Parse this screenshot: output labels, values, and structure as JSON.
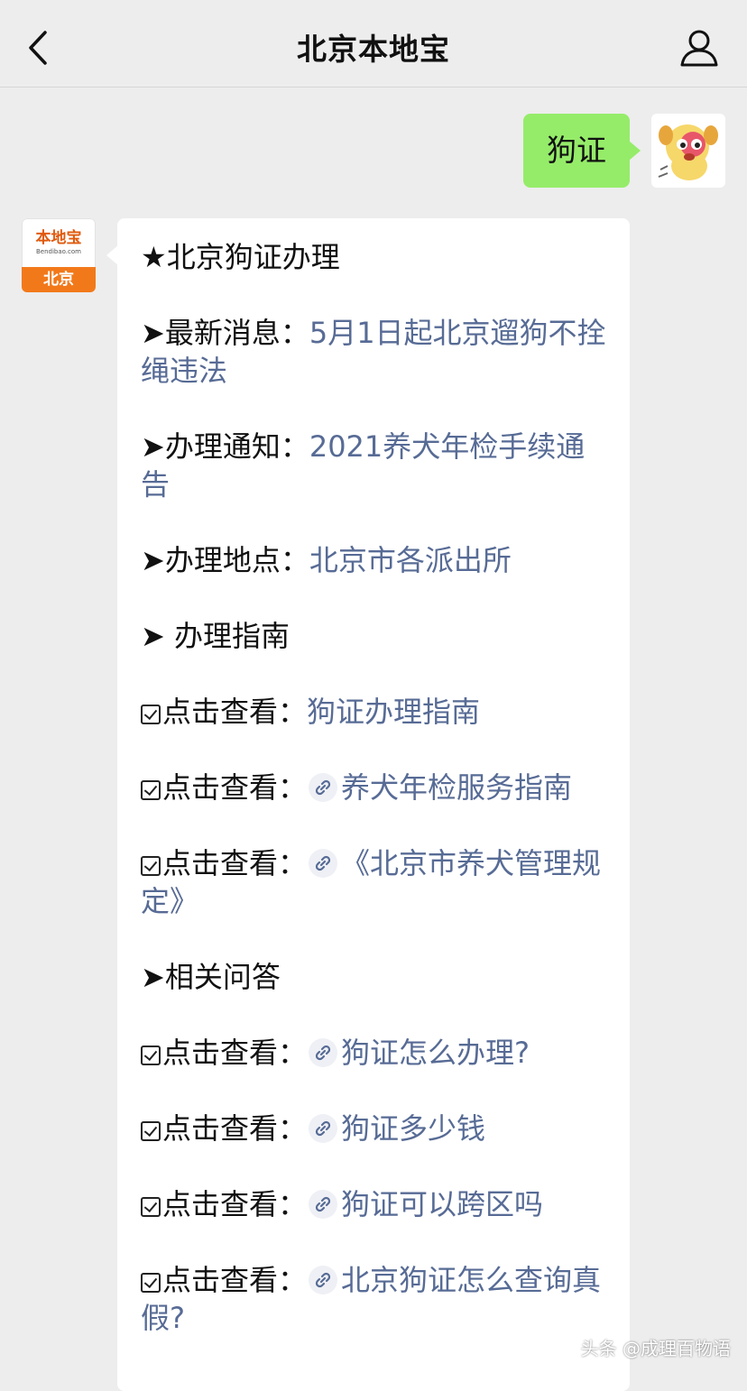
{
  "header": {
    "title": "北京本地宝"
  },
  "outgoing": {
    "text": "狗证"
  },
  "bot": {
    "logo_text": "本地宝",
    "logo_sub": "Bendibao.com",
    "city": "北京"
  },
  "reply": {
    "heading": "★北京狗证办理",
    "items": [
      {
        "label": "➤最新消息：",
        "link": "5月1日起北京遛狗不拴绳违法"
      },
      {
        "label": "➤办理通知：",
        "link": "2021养犬年检手续通告"
      },
      {
        "label": "➤办理地点：",
        "link": "北京市各派出所"
      },
      {
        "label": "➤ 办理指南",
        "link": ""
      },
      {
        "label": "点击查看：",
        "link": "狗证办理指南"
      },
      {
        "label": "点击查看：",
        "link": "养犬年检服务指南"
      },
      {
        "label": "点击查看：",
        "link": "《北京市养犬管理规定》"
      },
      {
        "label": "➤相关问答",
        "link": ""
      },
      {
        "label": "点击查看：",
        "link": "狗证怎么办理?"
      },
      {
        "label": "点击查看：",
        "link": "狗证多少钱"
      },
      {
        "label": "点击查看：",
        "link": "狗证可以跨区吗"
      },
      {
        "label": "点击查看：",
        "link": "北京狗证怎么查询真假?"
      }
    ]
  },
  "watermark": "头条 @成理百物语"
}
